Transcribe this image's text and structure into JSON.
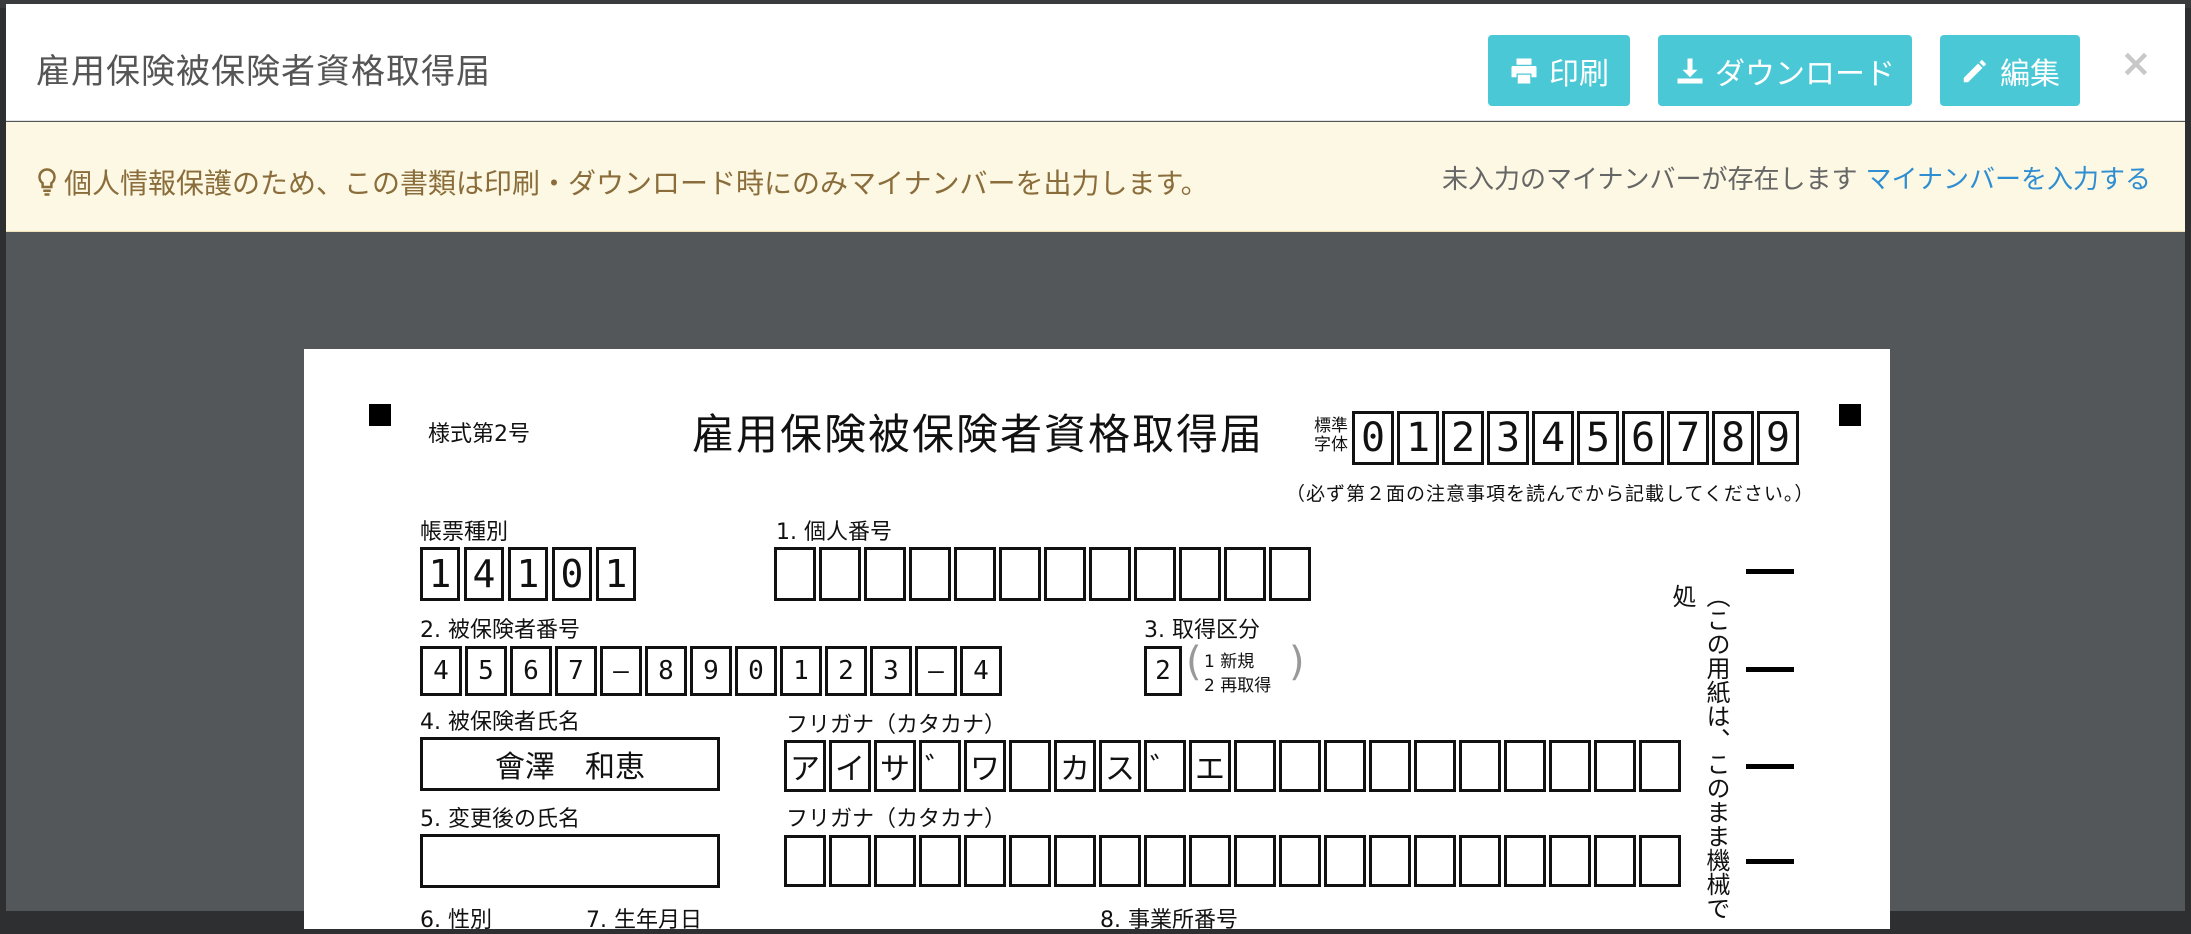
{
  "modal": {
    "title": "雇用保険被保険者資格取得届",
    "buttons": {
      "print": "印刷",
      "download": "ダウンロード",
      "edit": "編集"
    },
    "close_glyph": "×"
  },
  "notice": {
    "message": "個人情報保護のため、この書類は印刷・ダウンロード時にのみマイナンバーを出力します。",
    "status": "未入力のマイナンバーが存在します",
    "link": "マイナンバーを入力する"
  },
  "form": {
    "form_no": "様式第2号",
    "title": "雇用保険被保険者資格取得届",
    "std_label": "標準\n字体",
    "std_digits": [
      "0",
      "1",
      "2",
      "3",
      "4",
      "5",
      "6",
      "7",
      "8",
      "9"
    ],
    "instruction": "（必ず第２面の注意事項を読んでから記載してください。）",
    "form_type_label": "帳票種別",
    "form_type_digits": [
      "1",
      "4",
      "1",
      "0",
      "1"
    ],
    "personal_number_label": "1. 個人番号",
    "insured_number_label": "2. 被保険者番号",
    "insured_number_chars": [
      "4",
      "5",
      "6",
      "7",
      "—",
      "8",
      "9",
      "0",
      "1",
      "2",
      "3",
      "—",
      "4"
    ],
    "acquisition_label": "3. 取得区分",
    "acquisition_value": "2",
    "acquisition_option1": "1 新規",
    "acquisition_option2": "2 再取得",
    "name_label": "4. 被保険者氏名",
    "name_value": "會澤　和恵",
    "furigana_label": "フリガナ（カタカナ）",
    "furigana_chars": [
      "ア",
      "イ",
      "サ",
      "゛",
      "ワ",
      "",
      "カ",
      "ス",
      "゛",
      "エ",
      "",
      "",
      "",
      "",
      "",
      "",
      "",
      "",
      "",
      ""
    ],
    "changed_name_label": "5. 変更後の氏名",
    "furigana_label2": "フリガナ（カタカナ）",
    "gender_label": "6. 性別",
    "birth_label": "7. 生年月日",
    "office_label": "8. 事業所番号",
    "side_note": "（この用紙は、このまま機械で処"
  }
}
